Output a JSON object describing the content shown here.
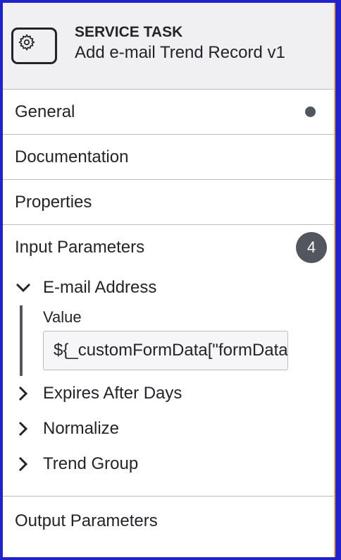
{
  "header": {
    "type_label": "SERVICE TASK",
    "task_name": "Add e-mail Trend Record v1",
    "icon": "gear-icon"
  },
  "groups": {
    "general": {
      "label": "General"
    },
    "documentation": {
      "label": "Documentation"
    },
    "properties": {
      "label": "Properties"
    },
    "input_parameters": {
      "label": "Input Parameters",
      "count": "4",
      "entries": [
        {
          "label": "E-mail Address",
          "expanded": true,
          "field_label": "Value",
          "field_value": "${_customFormData[\"formData\"][\"email\"]}"
        },
        {
          "label": "Expires After Days",
          "expanded": false
        },
        {
          "label": "Normalize",
          "expanded": false
        },
        {
          "label": "Trend Group",
          "expanded": false
        }
      ]
    },
    "output_parameters": {
      "label": "Output Parameters"
    }
  },
  "colors": {
    "frame": "#2222cc",
    "accent_border": "#e8b04a",
    "badge": "#52565f"
  }
}
